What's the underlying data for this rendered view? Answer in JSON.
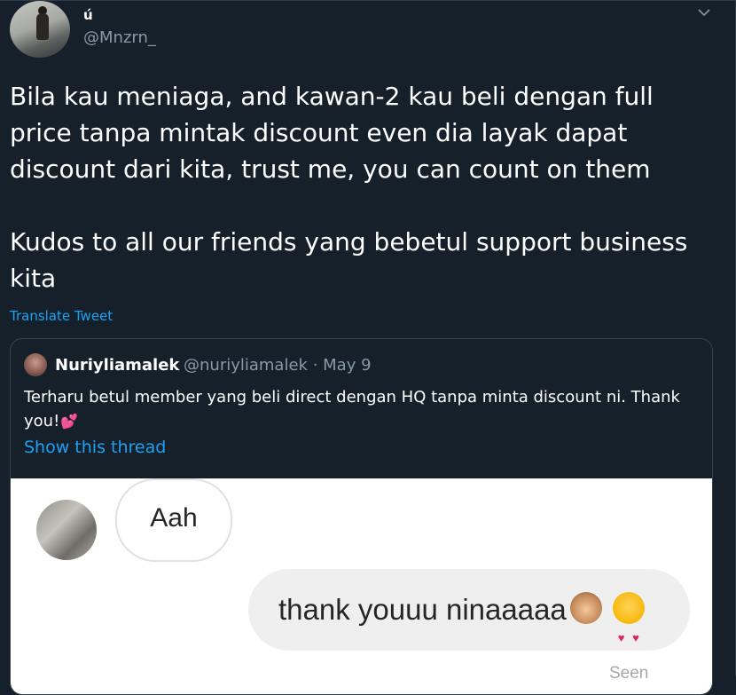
{
  "tweet": {
    "display_name": "ú",
    "handle": "@Mnzrn_",
    "text": "Bila kau meniaga, and kawan-2 kau beli dengan full price tanpa mintak discount even dia layak dapat discount dari kita, trust me, you can count on them\n\nKudos to all our friends yang bebetul support business kita",
    "translate_label": "Translate Tweet",
    "menu_icon": "chevron-down-icon"
  },
  "quoted": {
    "display_name": "Nuriyliamalek",
    "handle_date": "@nuriyliamalek · May 9",
    "text": "Terharu betul member yang beli direct dengan HQ tanpa minta discount ni. Thank you!",
    "text_emoji": "two-hearts-icon",
    "show_thread_label": "Show this thread"
  },
  "chat_image": {
    "received_message": "Aah",
    "sent_message": "thank youuu ninaaaaa",
    "sent_emojis": [
      "see-no-evil-monkey-icon",
      "heart-eyes-icon"
    ],
    "status": "Seen"
  },
  "colors": {
    "background": "#15202b",
    "accent": "#1da1f2",
    "secondary_text": "#8899a6",
    "border": "#38444d"
  }
}
